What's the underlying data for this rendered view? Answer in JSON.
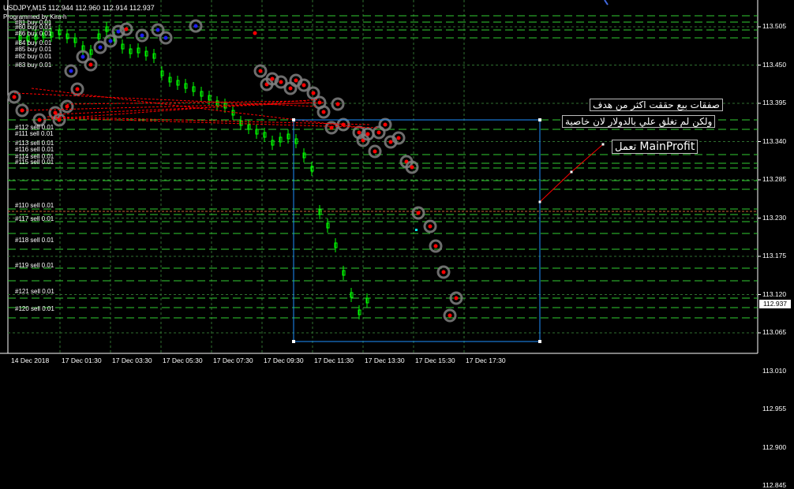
{
  "header": {
    "symbol_line": "USDJPY,M15  112.944 112.960 112.914 112.937",
    "programmer": "Programmed by Kira-h"
  },
  "buy_orders": [
    "#81 buy 0.01",
    "#80 buy 0.01",
    "#86 buy 0.01",
    "#84 buy 0.01",
    "#85 buy 0.01",
    "#82 buy 0.01",
    "#83 buy 0.01"
  ],
  "sell_orders_upper": [
    "#112 sell 0.01",
    "#111 sell 0.01",
    "#113 sell 0.01",
    "#116 sell 0.01",
    "#114 sell 0.01",
    "#115 sell 0.01"
  ],
  "sell_orders_lower": [
    "#110 sell 0.01",
    "#117 sell 0.01",
    "#118 sell 0.01",
    "#119 sell 0.01",
    "#121 sell 0.01",
    "#120 sell 0.01"
  ],
  "price_axis": [
    "113.505",
    "113.450",
    "113.395",
    "113.340",
    "113.285",
    "113.230",
    "113.175",
    "113.120",
    "113.065",
    "113.010",
    "112.955",
    "112.900",
    "112.845"
  ],
  "current_price": "112.937",
  "time_axis": [
    "14 Dec 2018",
    "17 Dec 01:30",
    "17 Dec 03:30",
    "17 Dec 05:30",
    "17 Dec 07:30",
    "17 Dec 09:30",
    "17 Dec 11:30",
    "17 Dec 13:30",
    "17 Dec 15:30",
    "17 Dec 17:30"
  ],
  "annotation": {
    "line1": "صفقات بيع حققت اكثر من هدف",
    "line2": "ولكن لم تغلق علي بالدولار لان خاصية",
    "line3_prefix": "تعمل",
    "line3_keyword": "MainProfit"
  },
  "colors": {
    "background": "#000000",
    "grid": "#2f6f2f",
    "order_line": "#32cd32",
    "bull_candle": "#00ff00",
    "marker_ring": "#808080",
    "sell_marker": "#ff0000",
    "buy_marker": "#1e1ef0",
    "rectangle": "#1e90ff",
    "trend_line": "#ff0000"
  },
  "chart_data": {
    "type": "candlestick",
    "symbol": "USDJPY",
    "timeframe": "M15",
    "ohlc_header": {
      "open": 112.944,
      "high": 112.96,
      "low": 112.914,
      "close": 112.937
    },
    "y_ticks": [
      113.505,
      113.45,
      113.395,
      113.34,
      113.285,
      113.23,
      113.175,
      113.12,
      113.065,
      113.01,
      112.955,
      112.9,
      112.845
    ],
    "x_ticks": [
      "14 Dec 2018",
      "17 Dec 01:30",
      "17 Dec 03:30",
      "17 Dec 05:30",
      "17 Dec 07:30",
      "17 Dec 09:30",
      "17 Dec 11:30",
      "17 Dec 13:30",
      "17 Dec 15:30",
      "17 Dec 17:30"
    ],
    "last_price": 112.937,
    "trend": "decline from about 113.51 to about 112.91 during the session"
  }
}
